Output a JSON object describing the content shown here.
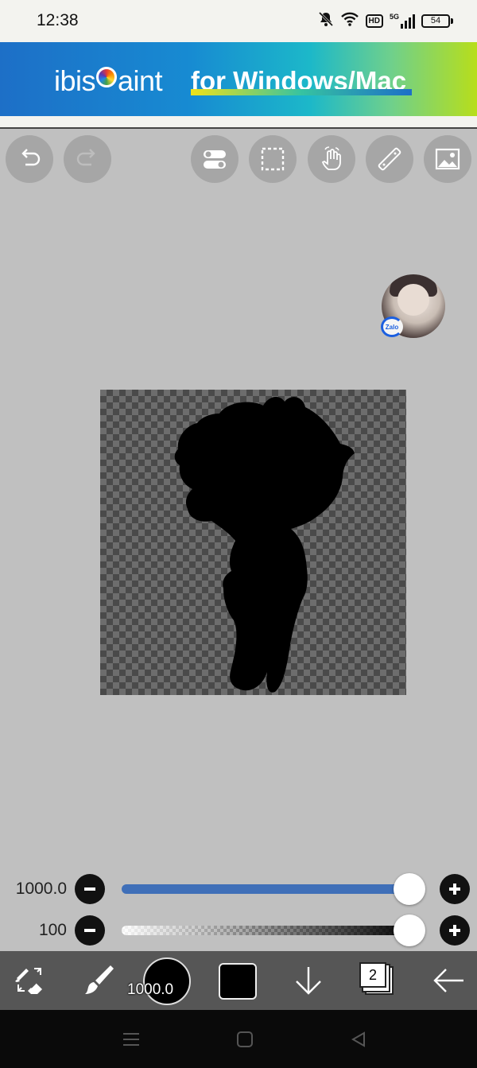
{
  "status_bar": {
    "time": "12:38",
    "hd_badge": "HD",
    "network": "5G",
    "battery": "54"
  },
  "banner": {
    "logo_prefix": "ibis",
    "logo_suffix": "aint",
    "title": "for Windows/Mac"
  },
  "toolbar": {
    "buttons": [
      "undo-icon",
      "redo-icon",
      "settings-toggle-icon",
      "selection-icon",
      "hand-gesture-icon",
      "ruler-icon",
      "image-icon"
    ]
  },
  "floating_bubble": {
    "app_tag": "Zalo"
  },
  "sliders": {
    "brush_size": {
      "value_label": "1000.0",
      "level": 1.0
    },
    "opacity": {
      "value_label": "100",
      "level": 1.0
    }
  },
  "bottom_toolbar": {
    "brush_size_label": "1000.0",
    "current_color": "#000000",
    "layer_count": "2"
  },
  "colors": {
    "canvas_background": "#c0c0c0",
    "slider_accent": "#3f6fb8",
    "bottom_bar": "#565656"
  }
}
